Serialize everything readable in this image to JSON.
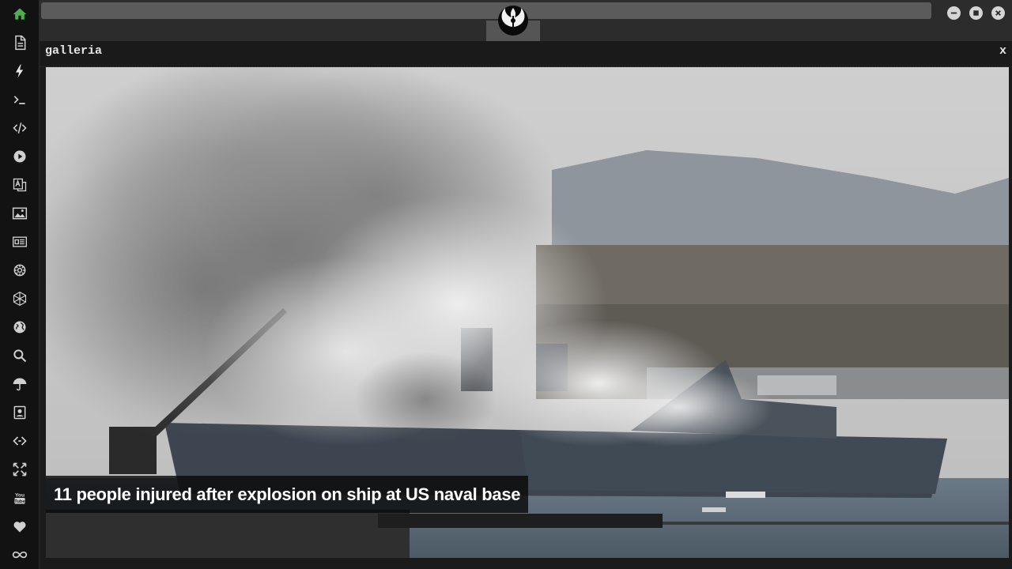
{
  "panel": {
    "title": "galleria",
    "close_label": "x"
  },
  "photo": {
    "caption": "11 people injured after explosion on ship at US naval base"
  },
  "sidebar": {
    "icons": [
      "home-icon",
      "document-icon",
      "lightning-icon",
      "terminal-icon",
      "code-icon",
      "play-icon",
      "translate-icon",
      "image-icon",
      "newspaper-icon",
      "settings-gear-icon",
      "network-icon",
      "globe-icon",
      "search-icon",
      "umbrella-icon",
      "contact-card-icon",
      "embed-icon",
      "expand-icon",
      "youtube-icon",
      "heart-icon",
      "infinity-icon"
    ]
  },
  "colors": {
    "accent": "#4caf50",
    "icon": "#d0d0d0",
    "background": "#121212"
  }
}
